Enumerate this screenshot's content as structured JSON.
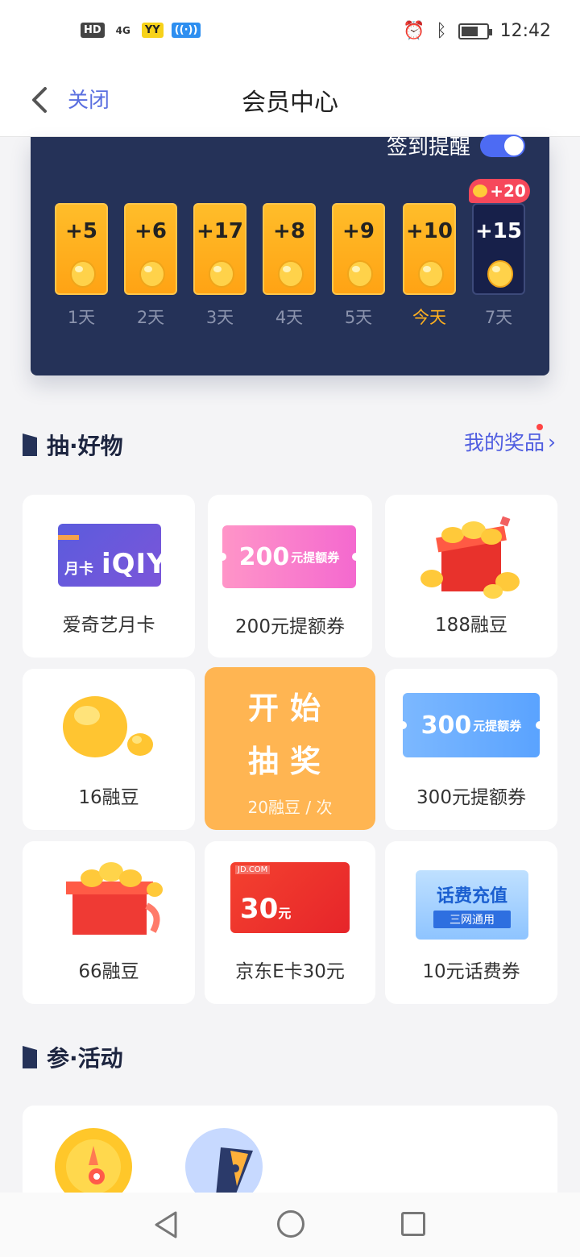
{
  "status_bar": {
    "hd": "HD",
    "network": "4G",
    "yy": "YY",
    "time": "12:42"
  },
  "nav": {
    "close_label": "关闭",
    "title": "会员中心"
  },
  "signin": {
    "reminder_label": "签到提醒",
    "reminder_on": true,
    "bonus": "+20",
    "days": [
      {
        "amount": "+5",
        "label": "1天"
      },
      {
        "amount": "+6",
        "label": "2天"
      },
      {
        "amount": "+17",
        "label": "3天"
      },
      {
        "amount": "+8",
        "label": "4天"
      },
      {
        "amount": "+9",
        "label": "5天"
      },
      {
        "amount": "+10",
        "label": "今天"
      },
      {
        "amount": "+15",
        "label": "7天"
      }
    ]
  },
  "lottery": {
    "section_title": "抽·好物",
    "my_prizes": "我的奖品",
    "items": [
      {
        "label": "爱奇艺月卡",
        "card_month": "月卡",
        "card_logo": "iQIY"
      },
      {
        "label": "200元提额券",
        "ticket_num": "200",
        "ticket_unit": "元提额券"
      },
      {
        "label": "188融豆"
      },
      {
        "label": "16融豆"
      },
      {
        "label": "300元提额券",
        "ticket_num": "300",
        "ticket_unit": "元提额券"
      },
      {
        "label": "66融豆"
      },
      {
        "label": "京东E卡30元",
        "jd_small": "JD.COM",
        "jd_amount": "30",
        "jd_unit": "元"
      },
      {
        "label": "10元话费券",
        "phone_title": "话费充值",
        "phone_sub": "三网通用"
      }
    ],
    "draw_button": {
      "title_line1": "开始",
      "title_line2": "抽奖",
      "cost": "20融豆 / 次"
    }
  },
  "activities": {
    "section_title": "参·活动"
  },
  "colors": {
    "panel_bg": "#253258",
    "accent_blue": "#4f5de0",
    "gold": "#ffa314",
    "draw_orange": "#ffb552"
  }
}
